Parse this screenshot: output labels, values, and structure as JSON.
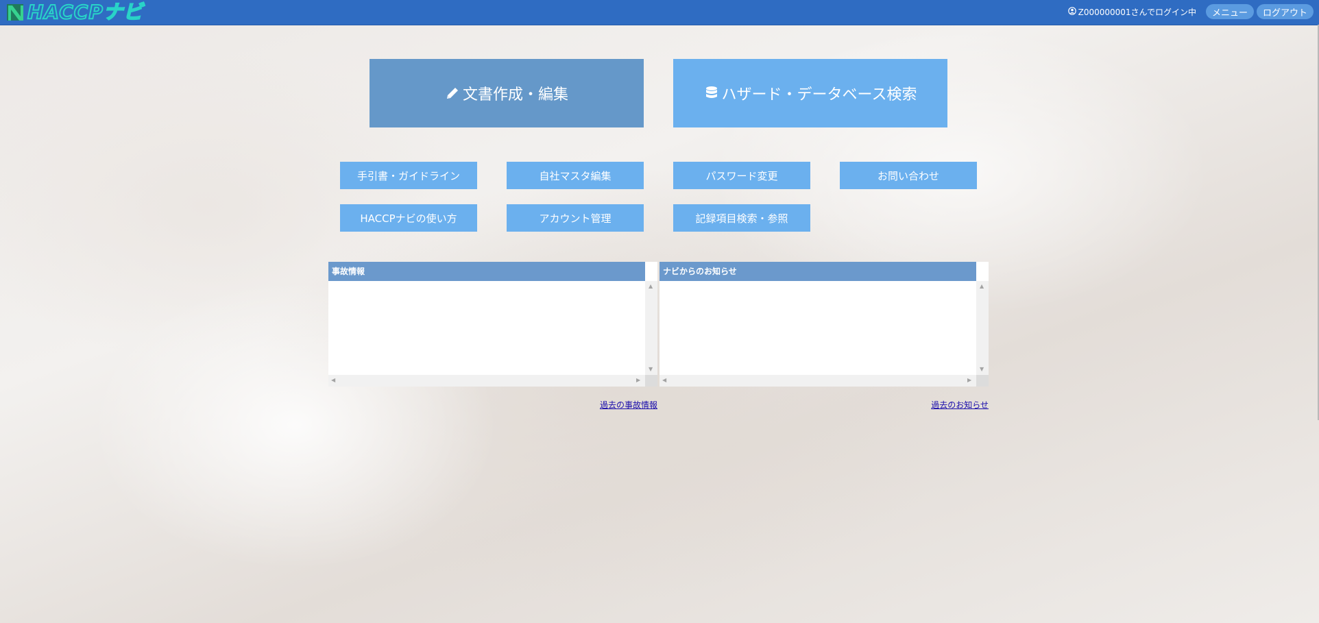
{
  "header": {
    "logo_text": "HACCPナビ",
    "user_text": "Z000000001さんでログイン中",
    "menu_label": "メニュー",
    "logout_label": "ログアウト",
    "background_color": "#2f6cc2"
  },
  "main_buttons": [
    {
      "label": "文書作成・編集",
      "icon": "pencil-icon",
      "color": "#6598c9"
    },
    {
      "label": "ハザード・データベース検索",
      "icon": "database-icon",
      "color": "#6bb0ee"
    }
  ],
  "sub_buttons": [
    {
      "label": "手引書・ガイドライン"
    },
    {
      "label": "自社マスタ編集"
    },
    {
      "label": "パスワード変更"
    },
    {
      "label": "お問い合わせ"
    },
    {
      "label": "HACCPナビの使い方"
    },
    {
      "label": "アカウント管理"
    },
    {
      "label": "記録項目検索・参照"
    }
  ],
  "panels": [
    {
      "title": "事故情報",
      "link": "過去の事故情報"
    },
    {
      "title": "ナビからのお知らせ",
      "link": "過去のお知らせ"
    }
  ]
}
